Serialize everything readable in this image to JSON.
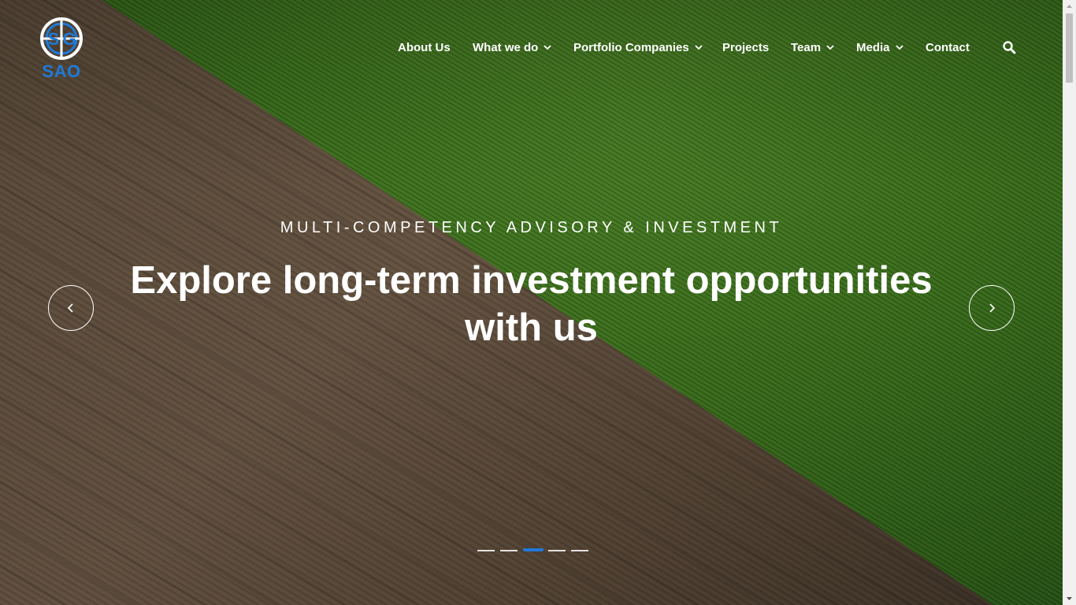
{
  "brand": {
    "logo_text": "SAO",
    "accent": "#1f7ad8"
  },
  "nav": {
    "items": [
      {
        "label": "About Us",
        "has_dropdown": false
      },
      {
        "label": "What we do",
        "has_dropdown": true
      },
      {
        "label": "Portfolio Companies",
        "has_dropdown": true
      },
      {
        "label": "Projects",
        "has_dropdown": false
      },
      {
        "label": "Team",
        "has_dropdown": true
      },
      {
        "label": "Media",
        "has_dropdown": true
      },
      {
        "label": "Contact",
        "has_dropdown": false
      }
    ],
    "search_icon": "search-icon"
  },
  "hero": {
    "eyebrow": "MULTI-COMPETENCY ADVISORY & INVESTMENT",
    "headline_line1": "Explore long-term investment opportunities",
    "headline_line2": "with us",
    "prev_icon": "chevron-left-icon",
    "next_icon": "chevron-right-icon"
  },
  "slider": {
    "slide_count": 5,
    "active_index": 2
  }
}
